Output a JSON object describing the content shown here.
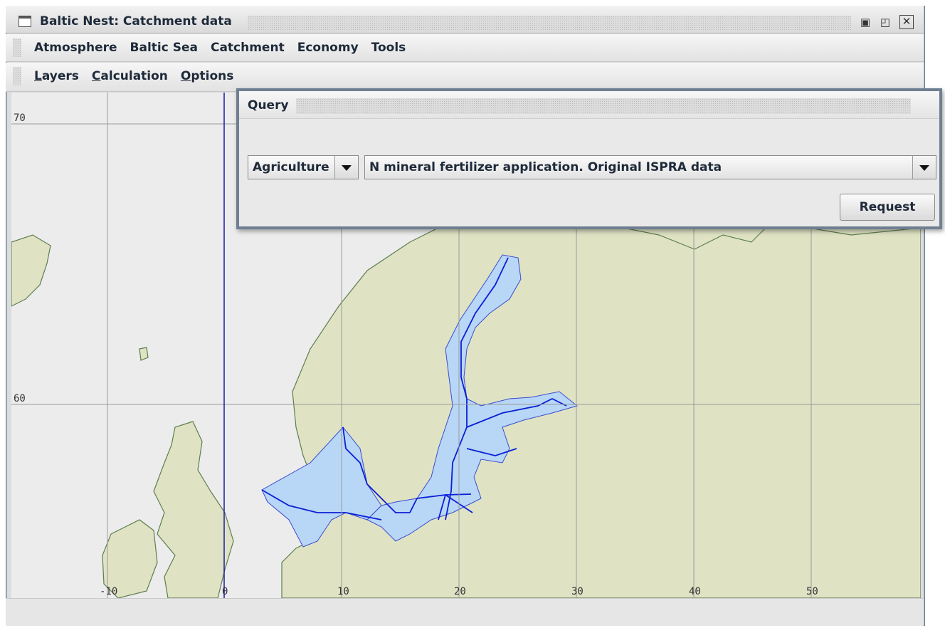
{
  "window": {
    "title": "Baltic Nest: Catchment data"
  },
  "menubar": {
    "items": [
      "Atmosphere",
      "Baltic Sea",
      "Catchment",
      "Economy",
      "Tools"
    ]
  },
  "submenu": {
    "items": [
      {
        "mnemonic": "L",
        "rest": "ayers"
      },
      {
        "mnemonic": "C",
        "rest": "alculation"
      },
      {
        "mnemonic": "O",
        "rest": "ptions"
      }
    ]
  },
  "query": {
    "title": "Query",
    "category": "Agriculture",
    "dataset": "N mineral fertilizer application. Original ISPRA data",
    "request_label": "Request"
  },
  "map": {
    "lat_labels": [
      "70",
      "60"
    ],
    "lon_labels": [
      "-10",
      "0",
      "10",
      "20",
      "30",
      "40",
      "50"
    ],
    "colors": {
      "land": "#dfe3c4",
      "sea": "#b8d6f5",
      "outline": "#5e7d4f",
      "basin_lines": "#0a1fd6",
      "background": "#ececec"
    }
  }
}
